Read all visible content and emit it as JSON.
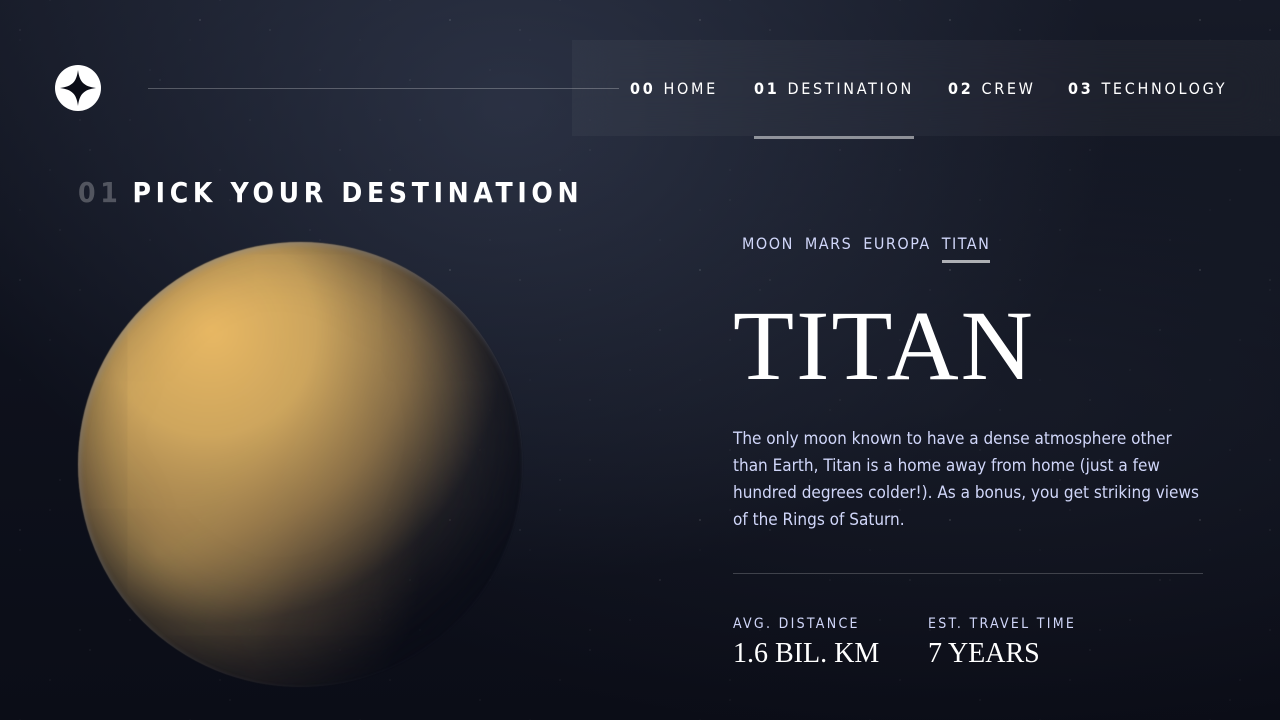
{
  "colors": {
    "background": "#0b0d17",
    "accent_text": "#d0d6f9",
    "white": "#ffffff"
  },
  "header": {
    "logo_icon": "four-point-star-icon",
    "nav": [
      {
        "num": "00",
        "label": "HOME",
        "active": false
      },
      {
        "num": "01",
        "label": "DESTINATION",
        "active": true
      },
      {
        "num": "02",
        "label": "CREW",
        "active": false
      },
      {
        "num": "03",
        "label": "TECHNOLOGY",
        "active": false
      }
    ]
  },
  "page": {
    "heading_num": "01",
    "heading": "PICK YOUR DESTINATION"
  },
  "destination": {
    "tabs": [
      "MOON",
      "MARS",
      "EUROPA",
      "TITAN"
    ],
    "active_tab": "TITAN",
    "name": "TITAN",
    "description": "The only moon known to have a dense atmosphere other than Earth, Titan is a home away from home (just a few hundred degrees colder!). As a bonus, you get striking views of the Rings of Saturn.",
    "stats": {
      "distance_label": "AVG. DISTANCE",
      "distance_value": "1.6 BIL. KM",
      "travel_label": "EST. TRAVEL TIME",
      "travel_value": "7 YEARS"
    }
  }
}
